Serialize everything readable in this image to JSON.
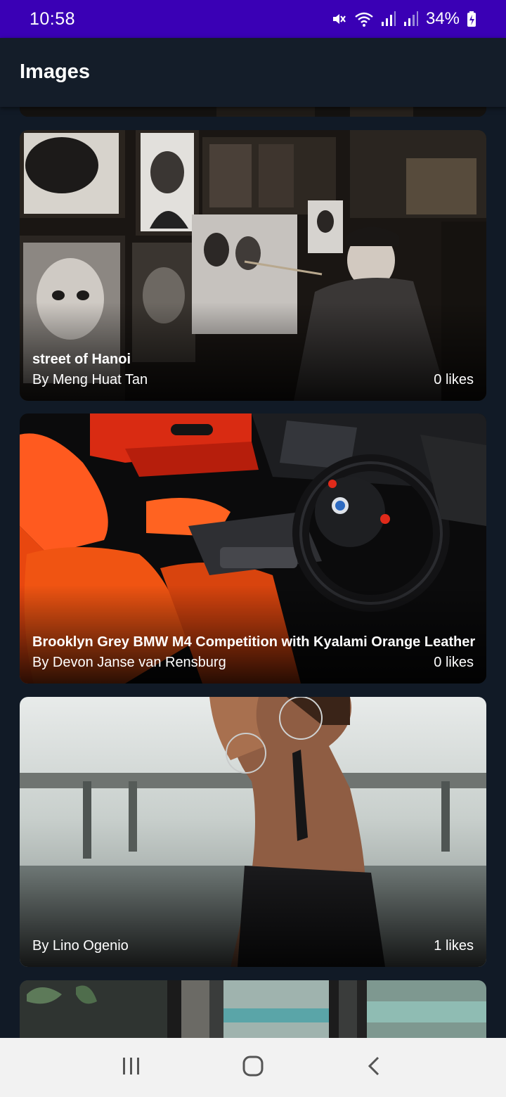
{
  "status_bar": {
    "time": "10:58",
    "battery": "34%",
    "icons": [
      "mute-icon",
      "wifi-icon",
      "signal-icon",
      "signal-icon",
      "battery-charging-icon"
    ],
    "background": "#3a00b5"
  },
  "app_bar": {
    "title": "Images"
  },
  "feed": {
    "background": "#111a26",
    "cards": [
      {
        "title": "street of Hanoi",
        "author": "By Meng Huat Tan",
        "likes": "0 likes"
      },
      {
        "title": "Brooklyn Grey BMW M4 Competition with Kyalami Orange Leather",
        "author": "By Devon Janse van Rensburg",
        "likes": "0 likes"
      },
      {
        "title": "",
        "author": "By Lino Ogenio",
        "likes": "1 likes"
      }
    ]
  },
  "nav_bar": {
    "buttons": [
      "recent-apps-icon",
      "home-icon",
      "back-icon"
    ]
  }
}
